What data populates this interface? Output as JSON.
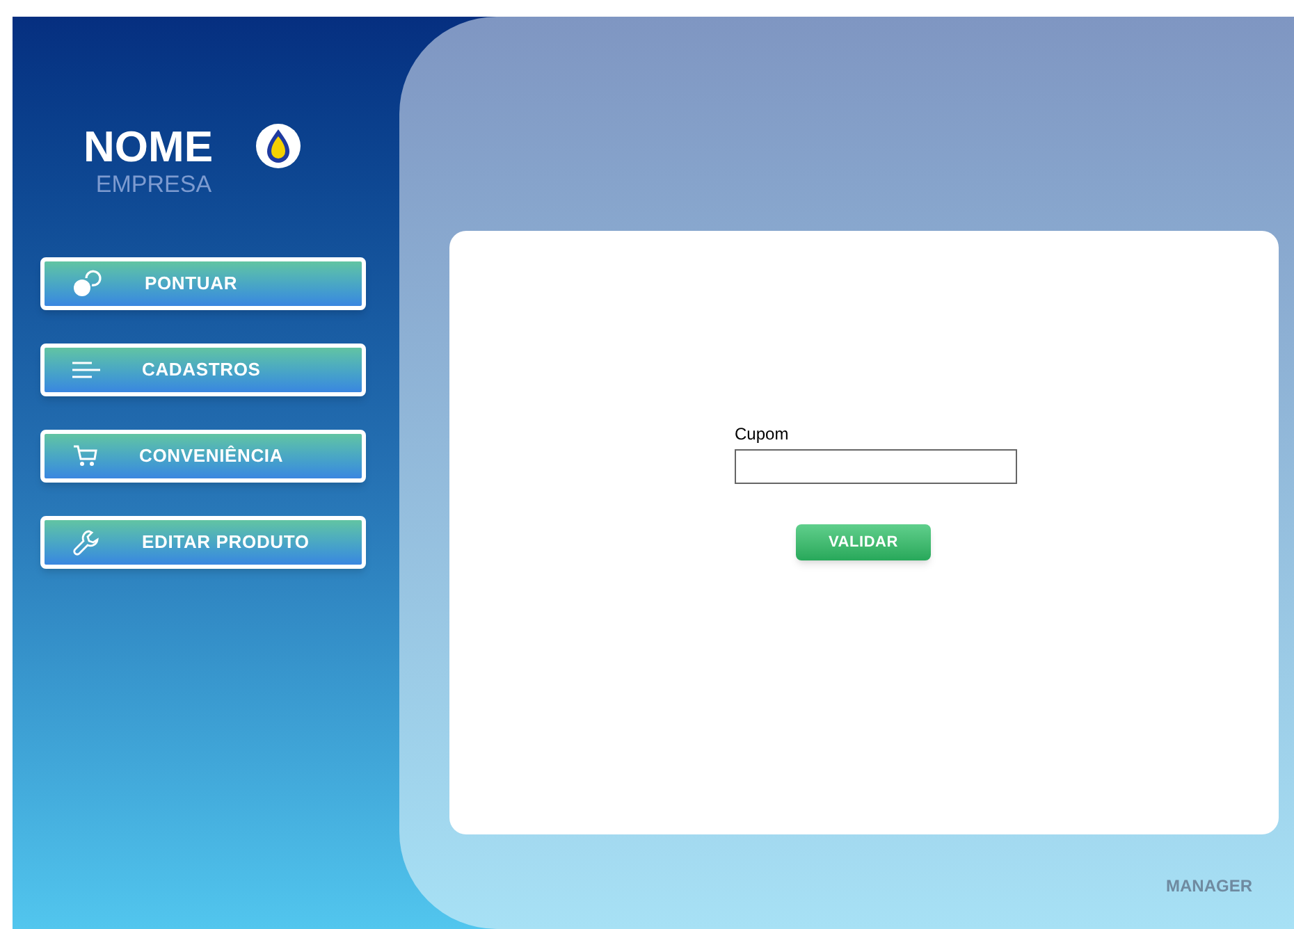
{
  "brand": {
    "name": "NOME",
    "subtitle": "EMPRESA"
  },
  "menu": [
    {
      "label": "PONTUAR",
      "kind": "points"
    },
    {
      "label": "CADASTROS",
      "kind": "list"
    },
    {
      "label": "CONVENIÊNCIA",
      "kind": "cart"
    },
    {
      "label": "EDITAR PRODUTO",
      "kind": "wrench"
    }
  ],
  "form": {
    "label": "Cupom",
    "button": "VALIDAR"
  },
  "footer": "MANAGER"
}
